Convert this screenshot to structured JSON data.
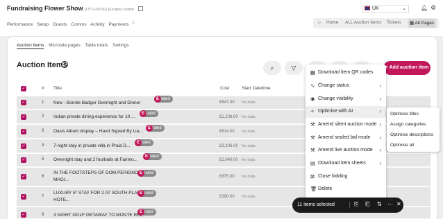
{
  "header": {
    "title": "Fundraising Flower Show",
    "timezone": "(UTC+00:00) Europe/London",
    "country": "UK",
    "nav": [
      "Performance",
      "Setup",
      "Guests",
      "Comms",
      "Activity",
      "Payments"
    ],
    "right_nav": [
      "Home",
      "ALL Auction Items",
      "Tickets",
      "All Pages"
    ]
  },
  "tabs": [
    "Auction Items",
    "Microsite pages",
    "Table totals",
    "Settings"
  ],
  "page": {
    "heading": "Auction Items",
    "add_button": "Add auction item"
  },
  "table": {
    "headers": [
      "#",
      "Title",
      "Cost",
      "Start Datetime"
    ],
    "rows": [
      {
        "num": "1",
        "title": "New - Bonnie Badger Overnight and Dinner",
        "cost": "£547.00",
        "date": "No data",
        "badge": "Sealed"
      },
      {
        "num": "2",
        "title": "Indian private dining experience for 10 ...",
        "cost": "£1,106.00",
        "date": "No data",
        "badge": "Sealed"
      },
      {
        "num": "3",
        "title": "Oasis Album display – Hand Signed By Lia...",
        "cost": "£614.00",
        "date": "No data",
        "badge": "Sealed"
      },
      {
        "num": "4",
        "title": "7-night stay in private villa in Praia D...",
        "cost": "£3,106.00",
        "date": "No data",
        "badge": "Sealed"
      },
      {
        "num": "5",
        "title": "Overnight stay and 2 fourballs at Fairmo...",
        "cost": "£1,640.00",
        "date": "No data",
        "badge": "Sealed"
      },
      {
        "num": "6",
        "title": "IN THE FOOTSTEPS OF DOM PERIGNON' A",
        "title2": "MAGI...",
        "cost": "£875.00",
        "date": "No data",
        "badge": "Sealed"
      },
      {
        "num": "7",
        "title": "LUXURY 5* STAY FOR 2 AT SOUTH PLACE",
        "title2": "HOTE...",
        "cost": "£390.00",
        "date": "No data",
        "badge": "Sealed"
      },
      {
        "num": "8",
        "title": "3 NIGHT GOLF GETAWAY TO MONTE REI,",
        "title2": "",
        "cost": "",
        "date": "",
        "badge": "Sealed"
      }
    ]
  },
  "menu": {
    "items": [
      "Download item QR codes",
      "Change status",
      "Change visibility",
      "Optimise with AI",
      "Amend silent auction mode",
      "Amend sealed bid mode",
      "Amend live auction mode",
      "Download item sheets",
      "Close bidding",
      "Delete"
    ],
    "submenu": [
      "Optimise titles",
      "Assign categories",
      "Optimise descriptions",
      "Optimise all"
    ]
  },
  "selection": {
    "label": "11 items selected"
  },
  "colors": {
    "accent": "#c2185b",
    "warning": "#f39c12",
    "sealed": "#8a8a8a"
  }
}
